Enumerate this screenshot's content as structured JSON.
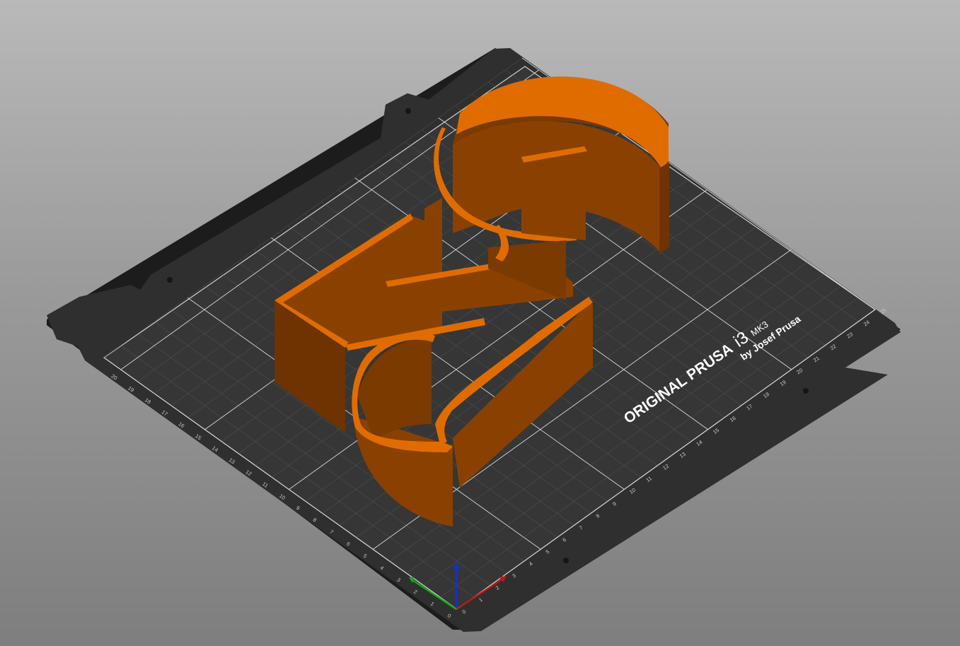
{
  "bed": {
    "brand_line": "ORIGINAL PRUSA",
    "model_i3": "i3",
    "model_mk3": "MK3",
    "byline": "by Josef Prusa",
    "colors": {
      "plate": "#2f2f2f",
      "plate_edge": "#1c1c1c",
      "grid_fine": "#5a5a5a",
      "grid_major": "#d8d8d8",
      "text": "#ffffff"
    }
  },
  "ticks": {
    "x_axis": [
      "0",
      "1",
      "2",
      "3",
      "4",
      "5",
      "6",
      "7",
      "8",
      "9",
      "10",
      "11",
      "12",
      "13",
      "14",
      "15",
      "16",
      "17",
      "18",
      "19",
      "20",
      "21",
      "22",
      "23",
      "24",
      "25"
    ],
    "y_axis": [
      "0",
      "1",
      "2",
      "3",
      "4",
      "5",
      "6",
      "7",
      "8",
      "9",
      "10",
      "11",
      "12",
      "13",
      "14",
      "15",
      "16",
      "17",
      "18",
      "19",
      "20"
    ]
  },
  "model": {
    "name": "number-2-cookie-cutter",
    "color_top": "#e06c00",
    "color_side": "#8a4100",
    "color_side_dark": "#6e3300"
  },
  "axes": {
    "x_color": "#c01818",
    "y_color": "#18a818",
    "z_color": "#1830c8"
  }
}
